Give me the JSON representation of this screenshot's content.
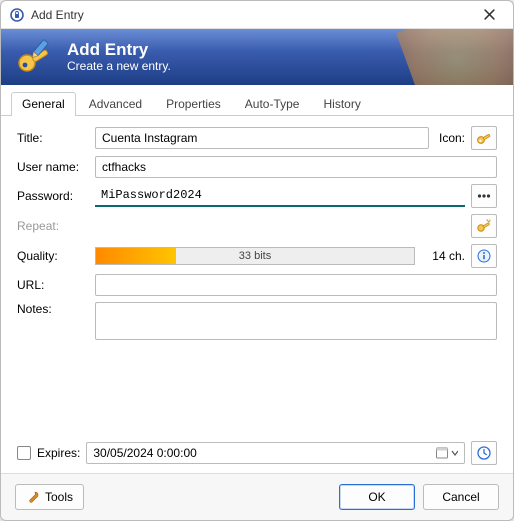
{
  "window": {
    "title": "Add Entry"
  },
  "banner": {
    "title": "Add Entry",
    "subtitle": "Create a new entry."
  },
  "tabs": {
    "general": "General",
    "advanced": "Advanced",
    "properties": "Properties",
    "autotype": "Auto-Type",
    "history": "History"
  },
  "labels": {
    "title": "Title:",
    "icon": "Icon:",
    "username": "User name:",
    "password": "Password:",
    "repeat": "Repeat:",
    "quality": "Quality:",
    "url": "URL:",
    "notes": "Notes:",
    "expires": "Expires:"
  },
  "values": {
    "title": "Cuenta Instagram",
    "username": "ctfhacks",
    "password": "MiPassword2024",
    "url": "",
    "notes": "",
    "expires": "30/05/2024  0:00:00"
  },
  "quality": {
    "bits_text": "33 bits",
    "chars_text": "14 ch.",
    "fill_percent": 25
  },
  "footer": {
    "tools": "Tools",
    "ok": "OK",
    "cancel": "Cancel"
  }
}
